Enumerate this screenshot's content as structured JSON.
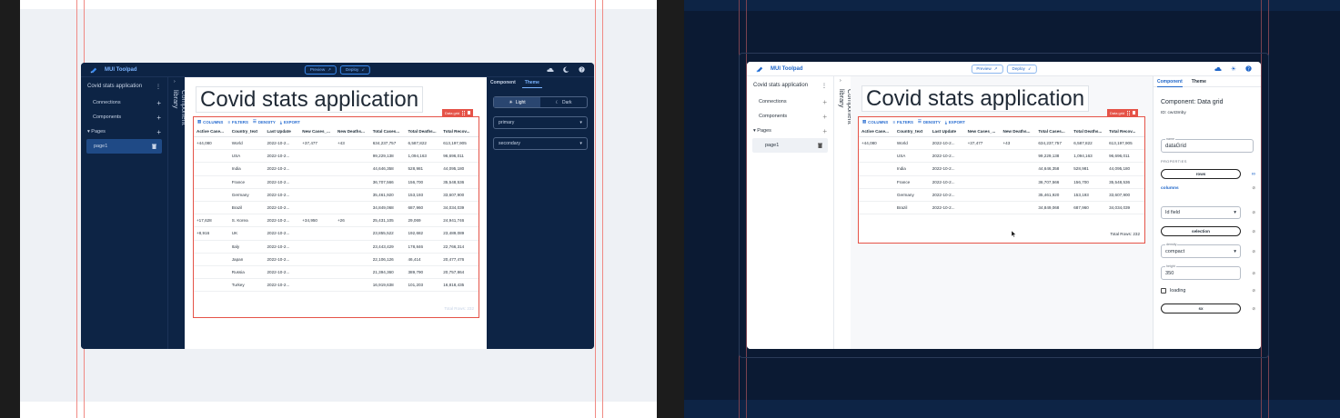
{
  "brand": {
    "name": "MUI Toolpad"
  },
  "toolbar": {
    "preview_label": "Preview",
    "deploy_label": "Deploy"
  },
  "hierarchy": {
    "app_name": "Covid stats application",
    "connections": "Connections",
    "components": "Components",
    "pages": "Pages",
    "page1": "page1"
  },
  "component_library_label": "Component library",
  "page_title": "Covid stats application",
  "grid": {
    "tag_label": "Data grid",
    "toolbar": {
      "columns": "COLUMNS",
      "filters": "FILTERS",
      "density": "DENSITY",
      "export": "EXPORT"
    },
    "headers": [
      "Active Case...",
      "Country_text",
      "Last Update",
      "New Cases_...",
      "New Deaths...",
      "Total Cases...",
      "Total Deaths...",
      "Total Recov..."
    ],
    "rows": [
      [
        "+44,080",
        "World",
        "2022-10-2...",
        "+37,477",
        "+43",
        "634,237,757",
        "6,587,822",
        "613,197,905"
      ],
      [
        "",
        "USA",
        "2022-10-2...",
        "",
        "",
        "99,229,138",
        "1,094,163",
        "96,696,011"
      ],
      [
        "",
        "India",
        "2022-10-2...",
        "",
        "",
        "44,646,358",
        "528,981",
        "44,095,180"
      ],
      [
        "",
        "France",
        "2022-10-2...",
        "",
        "",
        "36,707,566",
        "156,700",
        "35,548,536"
      ],
      [
        "",
        "Germany",
        "2022-10-2...",
        "",
        "",
        "35,461,920",
        "153,193",
        "33,607,900"
      ],
      [
        "",
        "Brazil",
        "2022-10-2...",
        "",
        "",
        "34,849,068",
        "687,960",
        "34,034,039"
      ],
      [
        "+17,628",
        "S. Korea",
        "2022-10-2...",
        "+34,950",
        "+26",
        "25,431,105",
        "29,069",
        "24,941,746"
      ],
      [
        "+8,916",
        "UK",
        "2022-10-2...",
        "",
        "",
        "23,855,522",
        "192,682",
        "23,489,089"
      ],
      [
        "",
        "Italy",
        "2022-10-2...",
        "",
        "",
        "23,443,429",
        "178,846",
        "22,766,314"
      ],
      [
        "",
        "Japan",
        "2022-10-2...",
        "",
        "",
        "22,106,126",
        "46,414",
        "20,477,476"
      ],
      [
        "",
        "Russia",
        "2022-10-2...",
        "",
        "",
        "21,394,360",
        "389,790",
        "20,757,864"
      ],
      [
        "",
        "Turkey",
        "2022-10-2...",
        "",
        "",
        "16,919,638",
        "101,203",
        "16,818,435"
      ]
    ],
    "footer": "Total Rows: 232"
  },
  "theme_panel": {
    "tabs": [
      "Component",
      "Theme"
    ],
    "light_label": "Light",
    "dark_label": "Dark",
    "primary_label": "primary",
    "secondary_label": "secondary"
  },
  "settings_panel": {
    "tabs": [
      "Component",
      "Theme"
    ],
    "heading": "Component: Data grid",
    "id_text": "ID: cw43mby",
    "name_label": "name",
    "name_value": "dataGrid",
    "properties_label": "PROPERTIES",
    "rows_label": "rows",
    "columns_label": "columns",
    "id_field_label": "Id field",
    "selection_label": "selection",
    "density_label": "density",
    "density_value": "compact",
    "height_label": "height",
    "height_value": "350",
    "loading_label": "loading",
    "sx_label": "sx"
  },
  "colors": {
    "dark_bg": "#0d2445",
    "accent_blue": "#3a8bf0",
    "selection_red": "#e55348",
    "guide_red": "#f08a84"
  }
}
